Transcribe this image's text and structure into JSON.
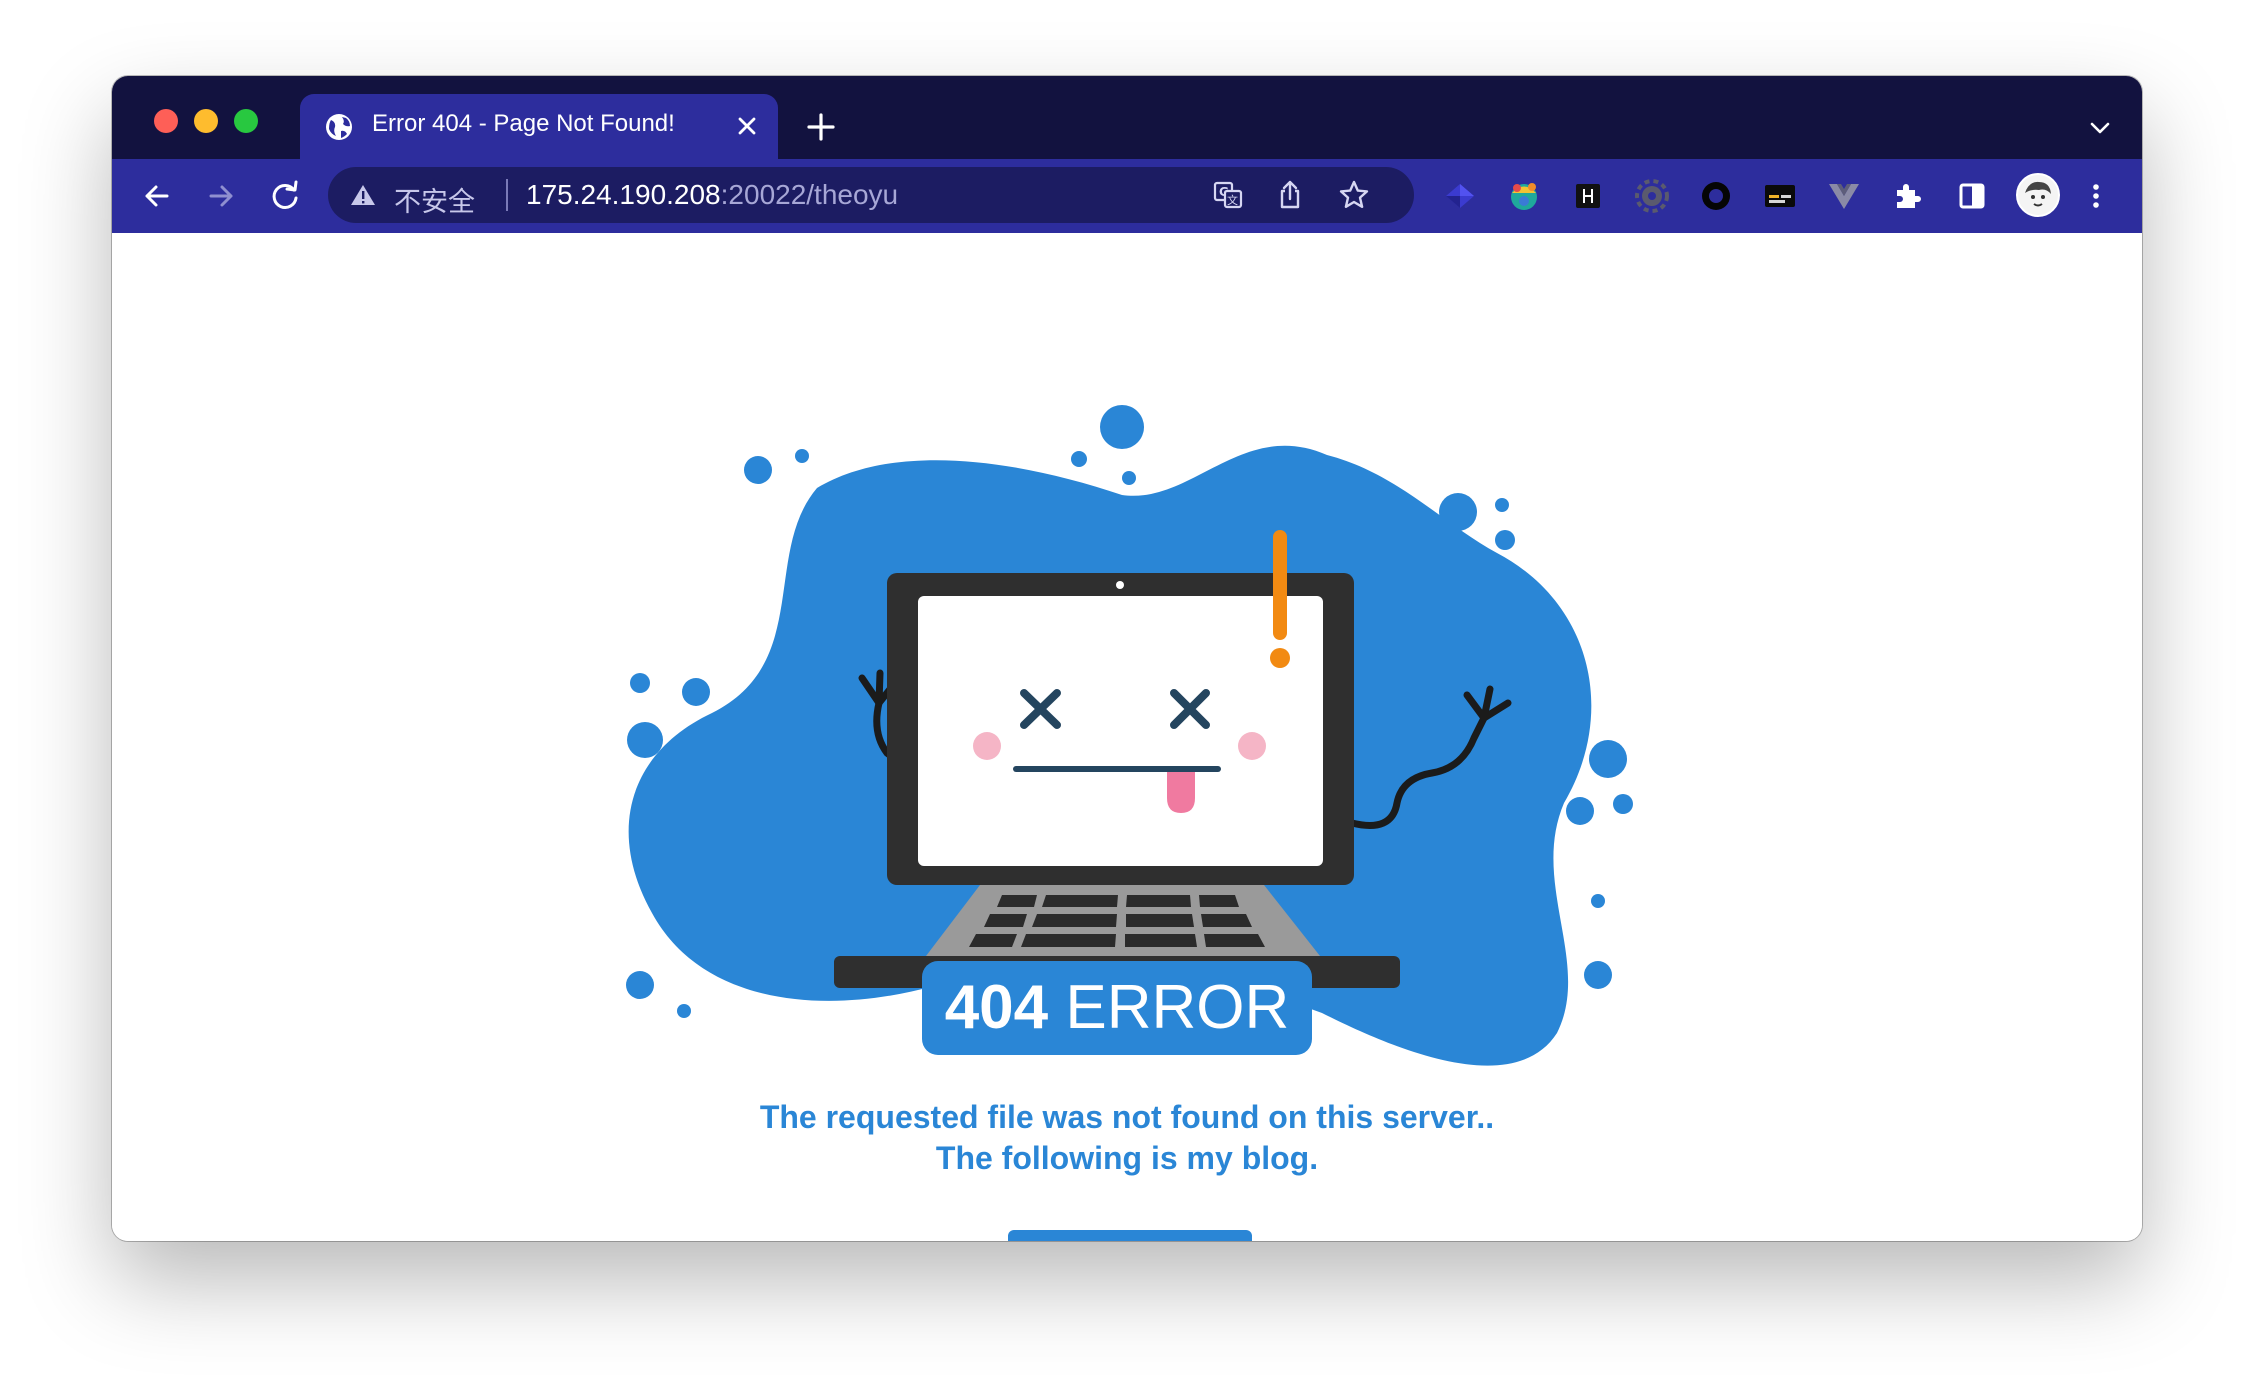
{
  "browser": {
    "tab": {
      "title": "Error 404 - Page Not Found!"
    },
    "address": {
      "security_label": "不安全",
      "host": "175.24.190.208",
      "port_path": ":20022/theoyu"
    },
    "extensions": [
      "layers-extension-icon",
      "color-globe-extension-icon",
      "h-extension-icon",
      "gear-extension-icon",
      "ring-extension-icon",
      "terminal-extension-icon",
      "vue-extension-icon",
      "puzzle-icon",
      "side-panel-icon",
      "profile-avatar"
    ]
  },
  "page": {
    "badge_number": "404",
    "badge_word": " ERROR",
    "message_line1": "The requested file was not found on this server..",
    "message_line2": "The following is my blog.",
    "accent_color": "#2a86d6"
  }
}
